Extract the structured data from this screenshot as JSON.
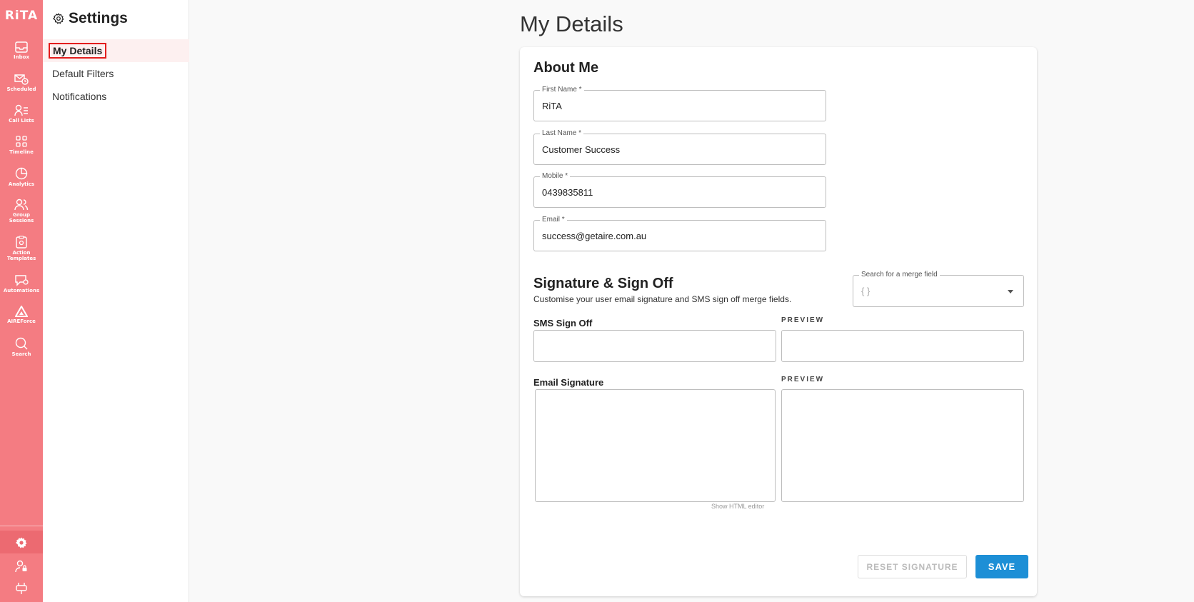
{
  "rail": {
    "logo": "RiTA",
    "items": [
      {
        "label": "Inbox",
        "icon": "inbox-icon"
      },
      {
        "label": "Scheduled",
        "icon": "scheduled-icon"
      },
      {
        "label": "Call Lists",
        "icon": "call-lists-icon"
      },
      {
        "label": "Timeline",
        "icon": "timeline-icon"
      },
      {
        "label": "Analytics",
        "icon": "analytics-icon"
      },
      {
        "label": "Group Sessions",
        "icon": "group-icon"
      },
      {
        "label": "Action Templates",
        "icon": "action-templates-icon"
      },
      {
        "label": "Automations",
        "icon": "automations-icon"
      },
      {
        "label": "AIREForce",
        "icon": "aireforce-icon"
      },
      {
        "label": "Search",
        "icon": "search-icon"
      }
    ],
    "bottom_icons": [
      "gear-icon",
      "user-lock-icon",
      "plug-icon"
    ]
  },
  "settings_panel": {
    "title": "Settings",
    "nav": [
      "My Details",
      "Default Filters",
      "Notifications"
    ]
  },
  "main": {
    "page_title": "My Details",
    "about": {
      "heading": "About Me",
      "fields": [
        {
          "label": "First Name *",
          "value": "RiTA"
        },
        {
          "label": "Last Name *",
          "value": "Customer Success"
        },
        {
          "label": "Mobile *",
          "value": "0439835811"
        },
        {
          "label": "Email *",
          "value": "success@getaire.com.au"
        }
      ]
    },
    "signature": {
      "heading": "Signature & Sign Off",
      "subtitle": "Customise your user email signature and SMS sign off merge fields.",
      "merge_field_label": "Search for a merge field",
      "merge_field_placeholder": "{ }",
      "sms_label": "SMS Sign Off",
      "email_label": "Email Signature",
      "preview_label": "PREVIEW",
      "html_editor_hint": "Show HTML editor"
    },
    "buttons": {
      "reset": "RESET SIGNATURE",
      "save": "SAVE"
    }
  },
  "colors": {
    "rail": "#f47c82",
    "save": "#1d8fd6",
    "highlight": "#e21d1d"
  }
}
